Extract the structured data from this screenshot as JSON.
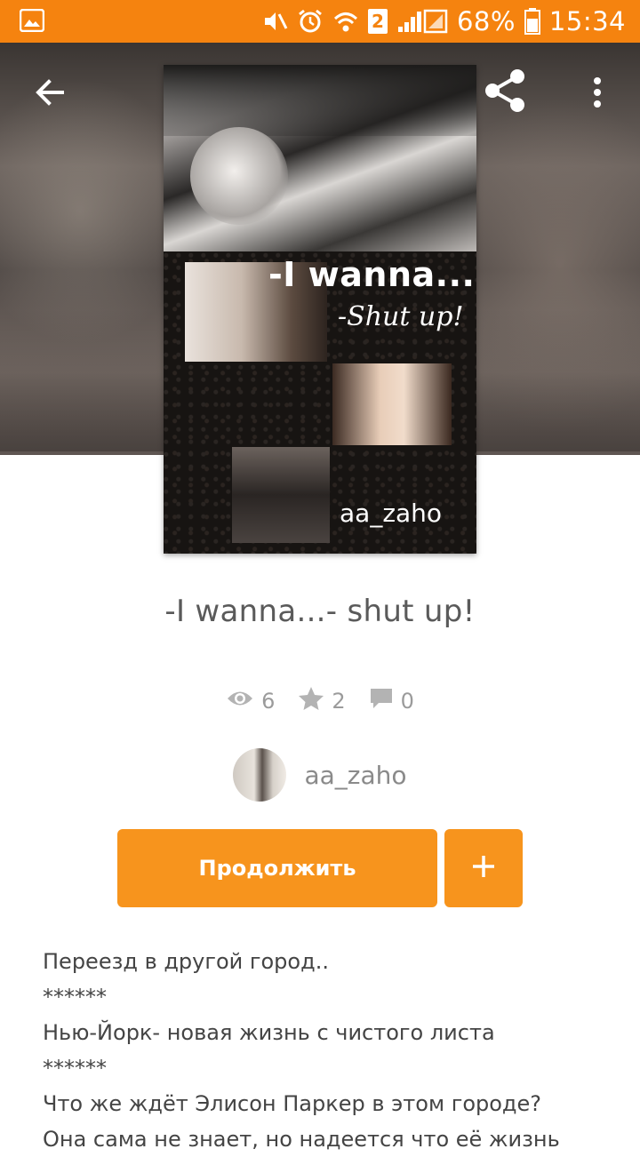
{
  "status_bar": {
    "battery": "68%",
    "time": "15:34",
    "sim_slot": "2",
    "icons": [
      "gallery-icon",
      "mute-icon",
      "alarm-icon",
      "wifi-icon",
      "signal-icon",
      "battery-icon"
    ]
  },
  "header": {
    "icons": [
      "back-arrow-icon",
      "share-icon",
      "more-vert-icon"
    ]
  },
  "cover": {
    "line1": "-I wanna...",
    "line2": "-Shut up!",
    "author": "aa_zaho"
  },
  "story": {
    "title": "-I wanna...- shut up!",
    "views": "6",
    "votes": "2",
    "comments": "0"
  },
  "author": {
    "name": "aa_zaho"
  },
  "actions": {
    "continue_label": "Продолжить",
    "add_label": "+"
  },
  "description": {
    "lines": [
      "Переезд в другой город..",
      "******",
      "Нью-Йорк- новая жизнь с чистого листа",
      "******",
      "Что же ждёт Элисон Паркер в этом городе?",
      "Она сама не знает, но надеется что её жизнь"
    ]
  },
  "colors": {
    "accent": "#f7941d",
    "status_bar": "#f5830f"
  }
}
